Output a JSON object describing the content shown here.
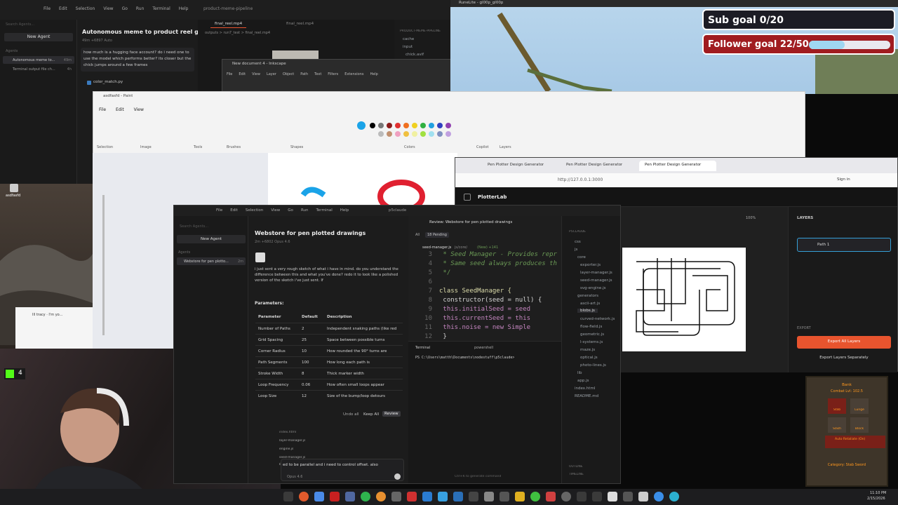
{
  "colors": {
    "accent_orange": "#e8542e",
    "goal_blue": "#9fd7f2",
    "code_purple": "#c586c0",
    "code_yellow": "#dcdcaa"
  },
  "vscode_top": {
    "menu": [
      "File",
      "Edit",
      "Selection",
      "View",
      "Go",
      "Run",
      "Terminal",
      "Help"
    ],
    "title": "product-meme-pipeline",
    "search_placeholder": "Search Agents...",
    "new_agent": "New Agent",
    "agents_label": "Agents",
    "agents": [
      {
        "label": "Autonomous meme to...",
        "time": "49m"
      },
      {
        "label": "Terminal output file ch...",
        "time": "4h"
      }
    ],
    "chat_title": "Autonomous meme to product reel gene...",
    "chat_meta": "49m  +6897  Auto",
    "chat_message": "how much is a hugging face account?  do i need one to use the model which performs better? its closer but the chick jumps around a few frames",
    "tabs": [
      "final_reel.mp4",
      "final_reel.mp4"
    ],
    "tab_sub": "outputs > run7_test > final_reel.mp4",
    "explorer_title": "PRODUCT-MEME-PIPELINE",
    "explorer_items": [
      "cache",
      "input",
      "chick.avif"
    ],
    "file_item": "color_match.py"
  },
  "inkscape": {
    "title": "New document 4 - Inkscape",
    "menu": [
      "File",
      "Edit",
      "View",
      "Layer",
      "Object",
      "Path",
      "Text",
      "Filters",
      "Extensions",
      "Help"
    ]
  },
  "stream_overlay": {
    "window_title": "RuneLite - gl00p_gl00p",
    "sub_goal": "Sub goal 0/20",
    "follower_goal": "Follower goal 22/50",
    "follower_progress": 0.44
  },
  "paint": {
    "title": "asdfasfd - Paint",
    "menu": [
      "File",
      "Edit",
      "View"
    ],
    "groups": [
      "Selection",
      "Image",
      "Tools",
      "Brushes",
      "Shapes",
      "Colors",
      "Copilot",
      "Layers"
    ]
  },
  "desktop": {
    "icon_label": "asdfasfd",
    "mini_browser_tab": "Ill tracy · I'm yo..."
  },
  "browser": {
    "tabs": [
      "Pen Plotter Design Generator",
      "Pen Plotter Design Generator",
      "Pen Plotter Design Generator"
    ],
    "url": "http://127.0.0.1:3000",
    "signin": "Sign in",
    "app_name": "PlotterLab",
    "zoom": "100%",
    "layers_title": "LAYERS",
    "layer_item": "Path 1",
    "export_title": "EXPORT",
    "export_all": "Export All Layers",
    "export_separate": "Export Layers Separately"
  },
  "cursor_win": {
    "menu": [
      "File",
      "Edit",
      "Selection",
      "View",
      "Go",
      "Run",
      "Terminal",
      "Help"
    ],
    "title": "p5claude",
    "search_placeholder": "Search Agents...",
    "new_agent": "New Agent",
    "agents_label": "Agents",
    "agent_item": "Webstore for pen plotto...",
    "agent_time": "2m",
    "chat_title": "Webstore for pen plotted drawings",
    "chat_meta": "2m  +6802  Opus 4.6",
    "chat_message": "i just sent a very rough sketch of what i have in mind. do you understand the difference between this and what you've done? redo it to look like a polished version of the sketch i've just sent.  If",
    "params_heading": "Parameters:",
    "param_headers": [
      "Parameter",
      "Default",
      "Description"
    ],
    "params": [
      [
        "Number of Paths",
        "2",
        "Independent snaking paths (like red"
      ],
      [
        "Grid Spacing",
        "25",
        "Space between possible turns"
      ],
      [
        "Corner Radius",
        "10",
        "How rounded the 90° turns are"
      ],
      [
        "Path Segments",
        "100",
        "How long each path is"
      ],
      [
        "Stroke Width",
        "8",
        "Thick marker width"
      ],
      [
        "Loop Frequency",
        "0.06",
        "How often small loops appear"
      ],
      [
        "Loop Size",
        "12",
        "Size of the bump/loop detours"
      ]
    ],
    "undo_all": "Undo all",
    "keep_all": "Keep All",
    "review": "Review",
    "changed_files": [
      "index.html",
      "layer-manager.js",
      "engine.js",
      "seed-manager.js",
      "blobs.js"
    ],
    "input_text": "ed to be parallel and i need to control offset.  also",
    "model": "Opus 4.6",
    "review_tab": "Review: Webstore for pen plotted drawings",
    "pending": "18 Pending",
    "all": "All",
    "file_path": "seed-manager.js",
    "file_path_sub": "js/core/",
    "file_meta": "(New) +141",
    "code_lines": [
      {
        "n": "3",
        "text": " * Seed Manager - Provides repr"
      },
      {
        "n": "4",
        "text": " * Same seed always produces th"
      },
      {
        "n": "5",
        "text": " */"
      },
      {
        "n": "6",
        "text": ""
      },
      {
        "n": "7",
        "text": "class SeedManager {"
      },
      {
        "n": "8",
        "text": "    constructor(seed = null) {"
      },
      {
        "n": "9",
        "text": "        this.initialSeed = seed"
      },
      {
        "n": "10",
        "text": "        this.currentSeed = this"
      },
      {
        "n": "11",
        "text": "        this.noise = new Simple"
      },
      {
        "n": "12",
        "text": "    }"
      }
    ],
    "terminal_label": "Terminal",
    "terminal_shell": "powershell",
    "terminal_prompt": "PS C:\\Users\\matth\\Documents\\nodestuff\\p5claude>",
    "explorer_title": "P5CLAUDE",
    "explorer_items": [
      "css",
      "js",
      "core",
      "exporter.js",
      "layer-manager.js",
      "seed-manager.js",
      "svg-engine.js",
      "generators",
      "ascii-art.js",
      "blobs.js",
      "curved-network.js",
      "flow-field.js",
      "geometric.js",
      "l-systems.js",
      "maze.js",
      "optical.js",
      "photo-lines.js",
      "lib",
      "app.js",
      "index.html",
      "README.md"
    ],
    "outline": "OUTLINE",
    "timeline": "TIMELINE",
    "status_hint": "Ctrl+K to generate command"
  },
  "runelite_panel": {
    "title": "Bank",
    "combat_level": "Combat Lvl: 102.5",
    "slots": [
      "Stab",
      "Lunge",
      "Slash",
      "Block"
    ],
    "auto_retaliate": "Auto Retaliate (On)",
    "category": "Category: Stab Sword"
  },
  "taskbar": {
    "time": "11:10 PM",
    "date": "2/15/2026"
  }
}
